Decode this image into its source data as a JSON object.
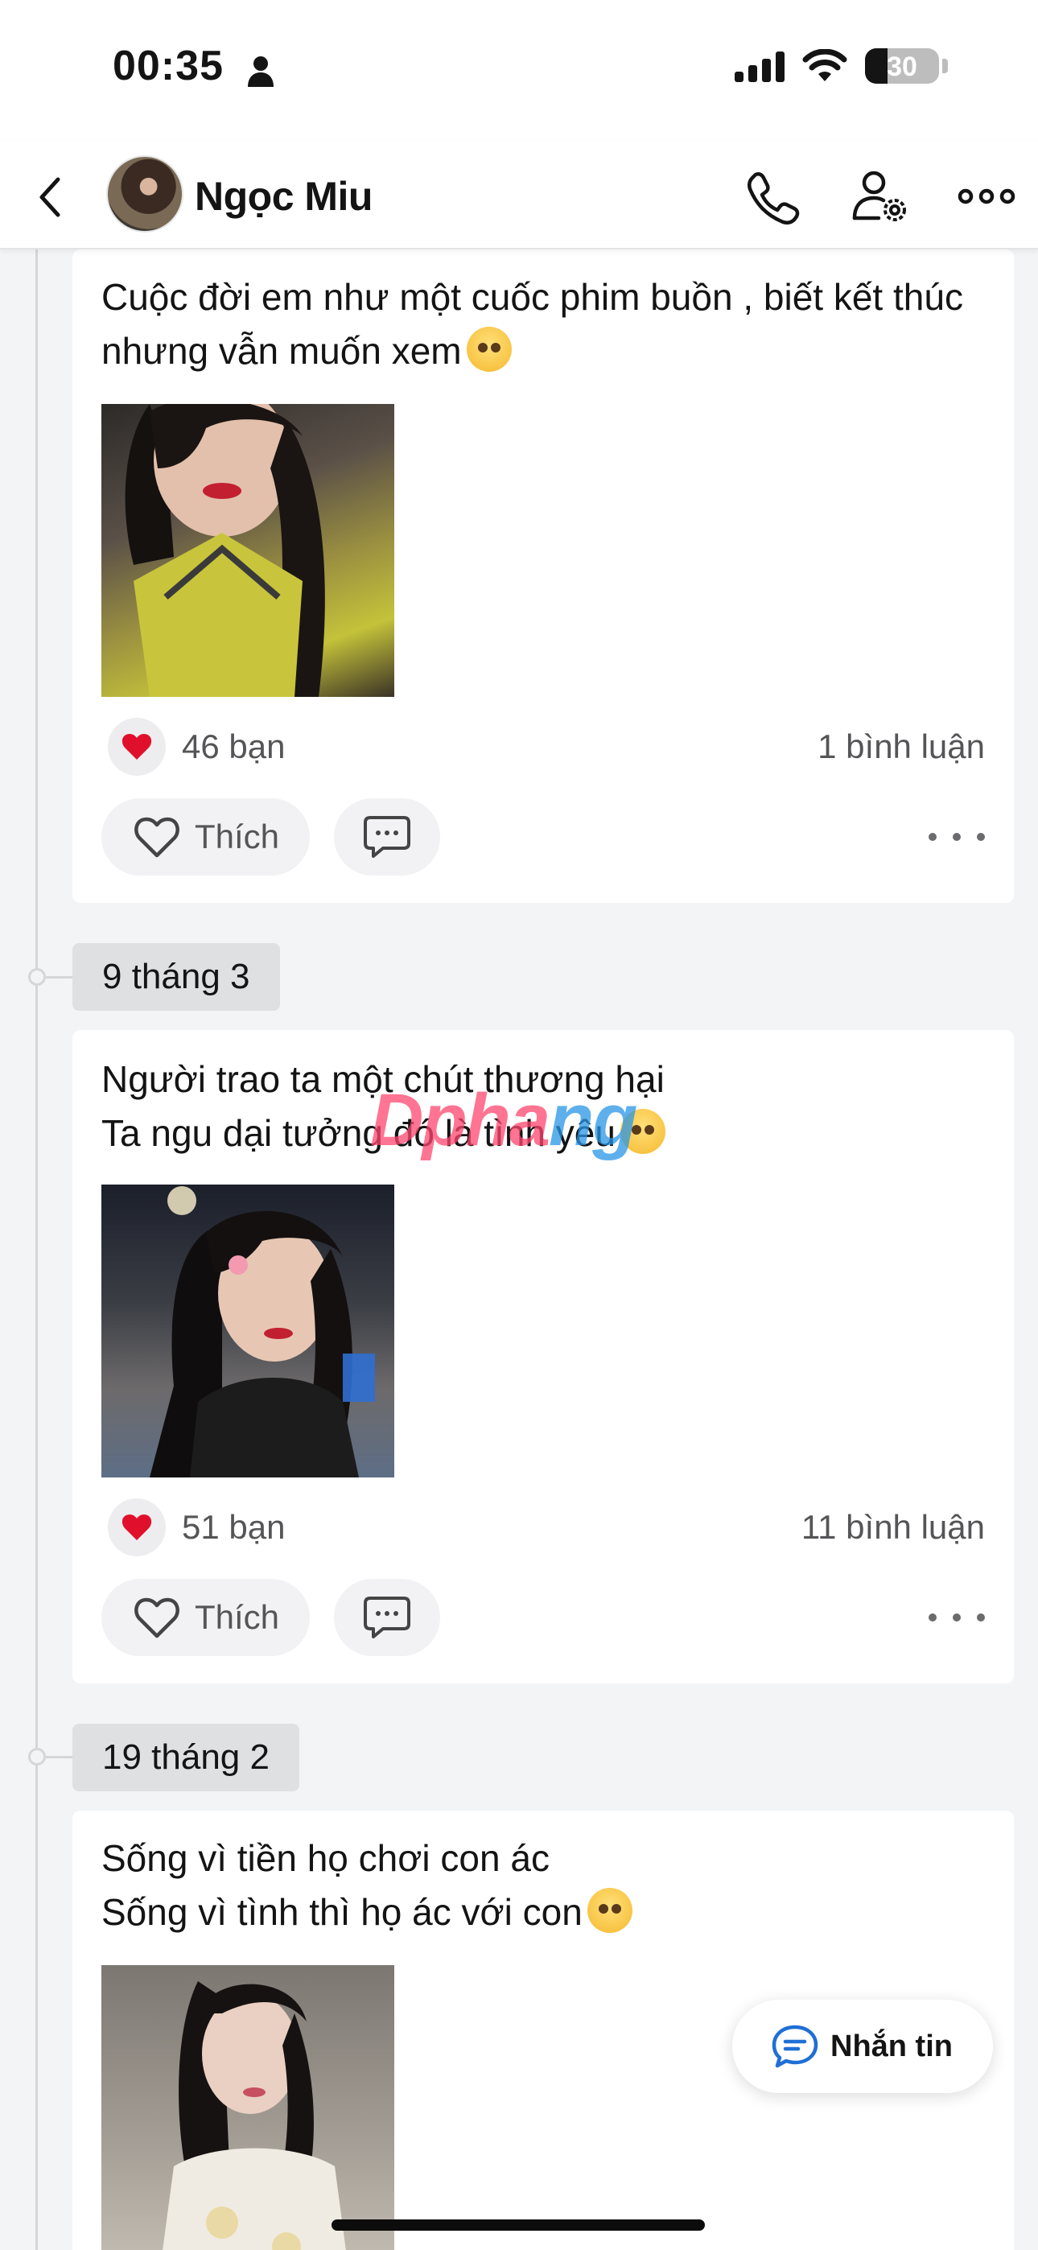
{
  "status_bar": {
    "time": "00:35",
    "battery": "30",
    "battery_level": 0.3
  },
  "header": {
    "profile_name": "Ngọc Miu"
  },
  "posts": [
    {
      "text": "Cuộc đời em như một cuốc phim buồn , biết kết thúc\nnhưng vẫn muốn xem",
      "likes": "46 bạn",
      "comments": "1 bình luận",
      "like_label": "Thích"
    },
    {
      "date": "9 tháng 3",
      "text": "Người trao ta một chút thương hại\nTa ngu dại tưởng đó là tình yêu",
      "likes": "51 bạn",
      "comments": "11 bình luận",
      "like_label": "Thích"
    },
    {
      "date": "19 tháng 2",
      "text": "Sống vì tiền họ chơi con ác\nSống vì tình thì họ ác với con"
    }
  ],
  "watermark": {
    "text_a": "Dpha",
    "text_b": "ng"
  },
  "floating": {
    "message_label": "Nhắn tin"
  },
  "colors": {
    "accent": "#1f6fd6",
    "heart": "#e0102c",
    "background": "#f3f4f6"
  },
  "icons": [
    "person-icon",
    "signal-icon",
    "wifi-icon",
    "battery-icon",
    "back-icon",
    "phone-icon",
    "user-settings-icon",
    "more-icon",
    "heart-icon",
    "comment-icon",
    "chat-icon"
  ]
}
